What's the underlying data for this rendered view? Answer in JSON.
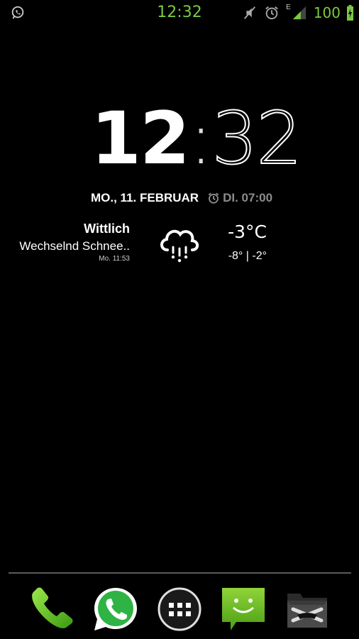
{
  "status_bar": {
    "time": "12:32",
    "network_type": "E",
    "battery_percent": "100",
    "left_icons": [
      "whatsapp-notification-icon"
    ],
    "right_icons": [
      "mute-icon",
      "alarm-icon",
      "signal-icon",
      "battery-charging-icon"
    ],
    "accent_color": "#7ac943"
  },
  "clock": {
    "hours": "12",
    "colon": ":",
    "minutes": "32"
  },
  "date_row": {
    "date": "MO., 11. FEBRUAR",
    "alarm": "DI. 07:00"
  },
  "weather": {
    "city": "Wittlich",
    "description": "Wechselnd Schnee..",
    "updated": "Mo. 11:53",
    "temperature": "-3°C",
    "range": "-8° | -2°",
    "icon": "snow-cloud-icon"
  },
  "dock": {
    "items": [
      {
        "name": "Phone",
        "icon": "phone-icon"
      },
      {
        "name": "WhatsApp",
        "icon": "whatsapp-icon"
      },
      {
        "name": "Apps",
        "icon": "app-drawer-icon"
      },
      {
        "name": "Messages",
        "icon": "messaging-icon"
      },
      {
        "name": "Pirate",
        "icon": "pirate-app-icon"
      }
    ]
  }
}
